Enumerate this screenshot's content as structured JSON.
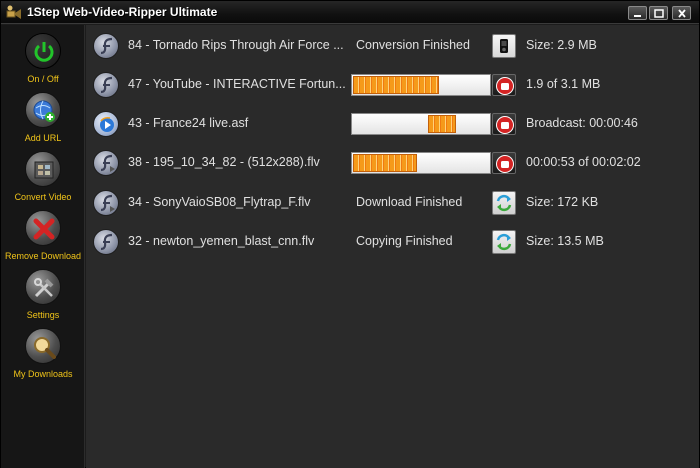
{
  "window": {
    "title": "1Step Web-Video-Ripper Ultimate"
  },
  "sidebar": {
    "items": [
      {
        "label": "On / Off",
        "icon": "power-icon"
      },
      {
        "label": "Add URL",
        "icon": "add-url-icon"
      },
      {
        "label": "Convert Video",
        "icon": "film-icon"
      },
      {
        "label": "Remove Download",
        "icon": "remove-x-icon"
      },
      {
        "label": "Settings",
        "icon": "tools-icon"
      },
      {
        "label": "My Downloads",
        "icon": "magnifier-icon"
      }
    ]
  },
  "downloads": [
    {
      "name": "84 - Tornado Rips Through Air Force ...",
      "type": "flash",
      "status": "Conversion Finished",
      "progress": null,
      "action": "device-icon",
      "info": "Size: 2.9 MB"
    },
    {
      "name": "47 - YouTube - INTERACTIVE Fortun...",
      "type": "flash",
      "status": "",
      "progress": 0.61,
      "action": "stop-icon",
      "info": "1.9 of 3.1 MB"
    },
    {
      "name": "43 - France24 live.asf",
      "type": "media",
      "status": "",
      "progress": "broadcast",
      "action": "stop-icon",
      "info": "Broadcast: 00:00:46"
    },
    {
      "name": "38 - 195_10_34_82 - (512x288).flv",
      "type": "flash-download",
      "status": "",
      "progress": 0.46,
      "action": "stop-icon",
      "info": "00:00:53 of 00:02:02"
    },
    {
      "name": "34 -  SonyVaioSB08_Flytrap_F.flv",
      "type": "flash-download",
      "status": "Download Finished",
      "progress": null,
      "action": "convert-icon",
      "info": "Size: 172 KB"
    },
    {
      "name": "32 - newton_yemen_blast_cnn.flv",
      "type": "flash",
      "status": "Copying Finished",
      "progress": null,
      "action": "convert-icon",
      "info": "Size: 13.5 MB"
    }
  ],
  "colors": {
    "sidebar_label": "#f0c419",
    "progress_orange": "#f59a1a",
    "stop_red": "#d42424",
    "power_green": "#22c42a"
  }
}
